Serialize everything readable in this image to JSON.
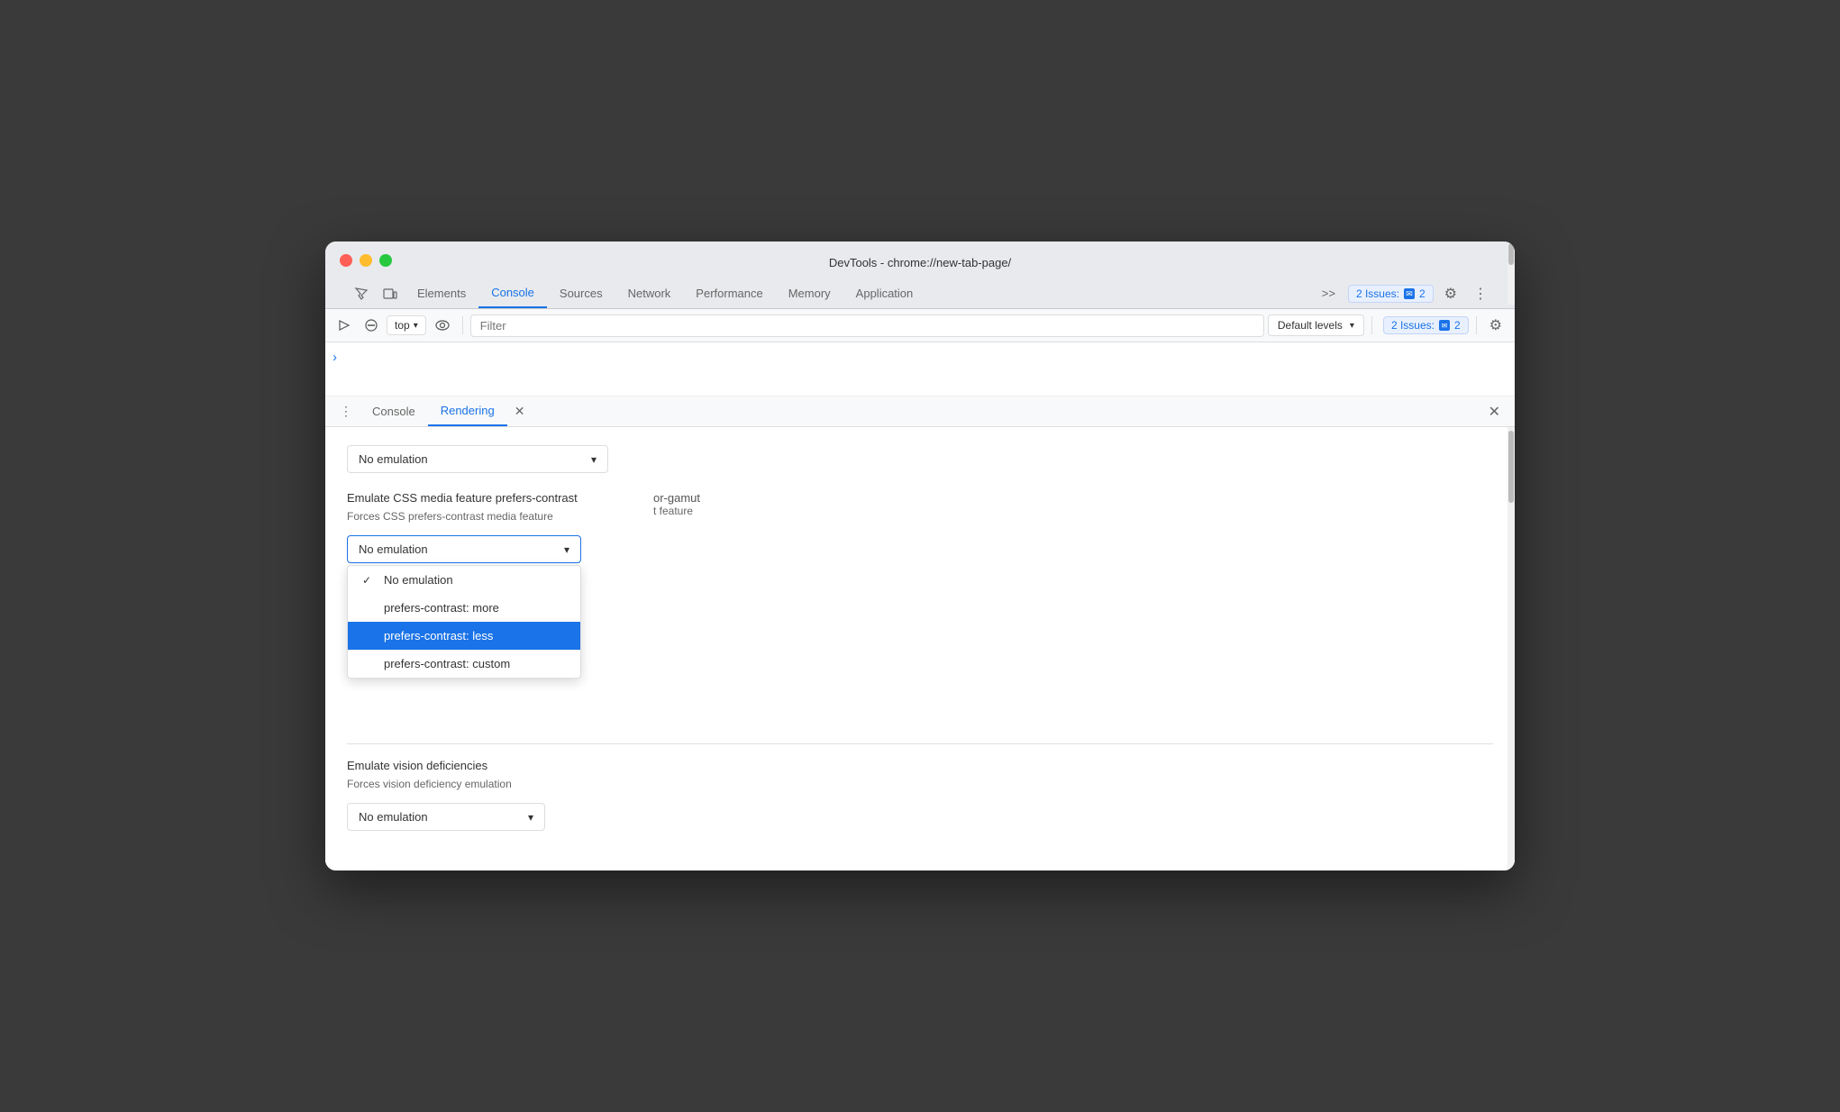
{
  "window": {
    "title": "DevTools - chrome://new-tab-page/"
  },
  "traffic_lights": {
    "close_label": "close",
    "min_label": "minimize",
    "max_label": "maximize"
  },
  "tabs": {
    "items": [
      {
        "id": "elements",
        "label": "Elements",
        "active": false
      },
      {
        "id": "console",
        "label": "Console",
        "active": true
      },
      {
        "id": "sources",
        "label": "Sources",
        "active": false
      },
      {
        "id": "network",
        "label": "Network",
        "active": false
      },
      {
        "id": "performance",
        "label": "Performance",
        "active": false
      },
      {
        "id": "memory",
        "label": "Memory",
        "active": false
      },
      {
        "id": "application",
        "label": "Application",
        "active": false
      }
    ],
    "more_label": ">>",
    "issues_label": "2 Issues:",
    "issues_count": "2"
  },
  "toolbar": {
    "top_selector_value": "top",
    "filter_placeholder": "Filter",
    "default_levels_label": "Default levels"
  },
  "console": {
    "prompt_char": ">"
  },
  "drawer": {
    "menu_icon": "⋮",
    "tabs": [
      {
        "id": "console",
        "label": "Console",
        "active": false,
        "closeable": false
      },
      {
        "id": "rendering",
        "label": "Rendering",
        "active": true,
        "closeable": true
      }
    ],
    "close_all_label": "✕",
    "sections": [
      {
        "id": "emulate-color-scheme",
        "label": "No emulation",
        "dropdown_value": "No emulation"
      },
      {
        "id": "emulate-contrast",
        "title": "Emulate CSS media feature prefers-contrast",
        "subtitle": "Forces CSS prefers-contrast media feature",
        "dropdown_value": "No emulation",
        "dropdown_open": true,
        "options": [
          {
            "id": "no-emulation",
            "label": "No emulation",
            "checked": true,
            "selected": false
          },
          {
            "id": "more",
            "label": "prefers-contrast: more",
            "checked": false,
            "selected": false
          },
          {
            "id": "less",
            "label": "prefers-contrast: less",
            "checked": false,
            "selected": true
          },
          {
            "id": "custom",
            "label": "prefers-contrast: custom",
            "checked": false,
            "selected": false
          }
        ],
        "partial_labels": [
          {
            "text": "or-gamut",
            "desc": "t feature"
          }
        ]
      },
      {
        "id": "emulate-vision",
        "title": "Emulate vision deficiencies",
        "subtitle": "Forces vision deficiency emulation",
        "dropdown_value": "No emulation"
      }
    ]
  }
}
